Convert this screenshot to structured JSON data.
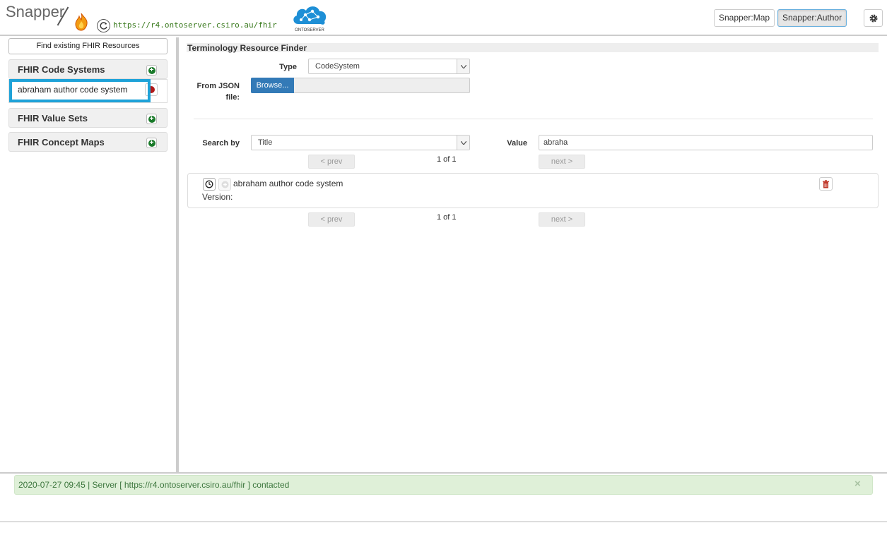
{
  "header": {
    "app_name": "Snapper",
    "server_url": "https://r4.ontoserver.csiro.au/fhir",
    "ontoserver_label": "ONTOSERVER",
    "map_button": "Snapper:Map",
    "author_button": "Snapper:Author",
    "active_mode": "Snapper:Author"
  },
  "sidebar": {
    "find_button": "Find existing FHIR Resources",
    "sections": [
      {
        "title": "FHIR Code Systems",
        "items": [
          "abraham author code system"
        ]
      },
      {
        "title": "FHIR Value Sets",
        "items": []
      },
      {
        "title": "FHIR Concept Maps",
        "items": []
      }
    ]
  },
  "main": {
    "title": "Terminology Resource Finder",
    "type_label": "Type",
    "type_value": "CodeSystem",
    "json_label_line1": "From JSON",
    "json_label_line2": "file:",
    "browse_label": "Browse...",
    "search_by_label": "Search by",
    "search_by_value": "Title",
    "value_label": "Value",
    "value_input": "abraha",
    "prev_label": "< prev",
    "next_label": "next >",
    "page_count": "1 of 1",
    "results": [
      {
        "title": "abraham author code system",
        "version_label": "Version:"
      }
    ]
  },
  "status": {
    "message": "2020-07-27 09:45 | Server [ https://r4.ontoserver.csiro.au/fhir ] contacted",
    "close_symbol": "×"
  },
  "colors": {
    "accent": "#337ab7",
    "highlight": "#1ea2d8",
    "success_bg": "#dff0d8",
    "url_green": "#3a7a1e"
  }
}
